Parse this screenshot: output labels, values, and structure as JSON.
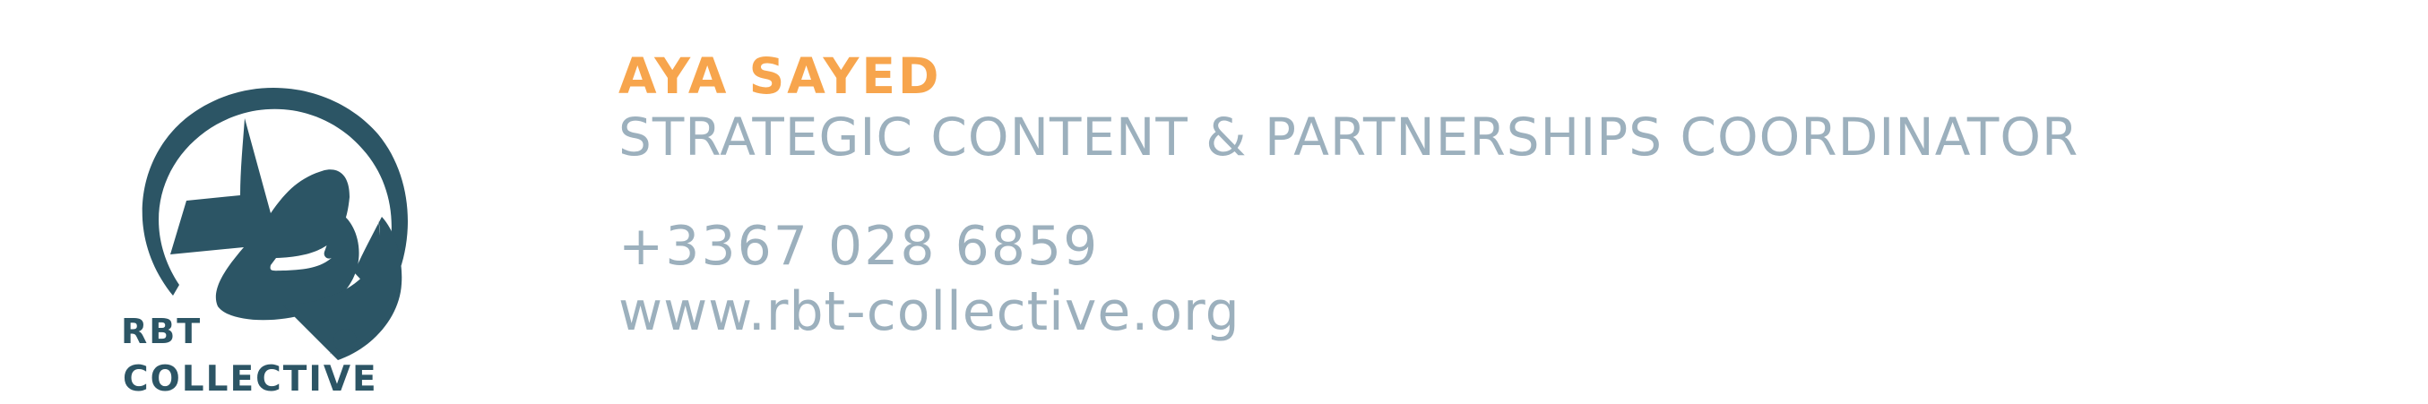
{
  "logo": {
    "line1": "RBT",
    "line2": "COLLECTIVE"
  },
  "contact": {
    "name": "AYA SAYED",
    "title": "STRATEGIC CONTENT & PARTNERSHIPS COORDINATOR",
    "phone": "+3367 028 6859",
    "website": "www.rbt-collective.org"
  },
  "colors": {
    "logo": "#2c5565",
    "name": "#f7a54d",
    "text": "#9cb0bd",
    "background": "#ffffff"
  }
}
